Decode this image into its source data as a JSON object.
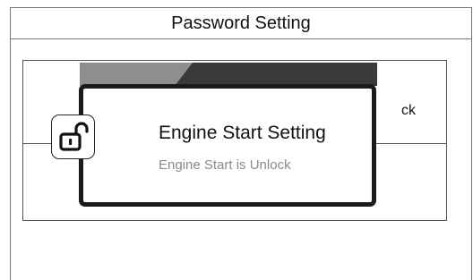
{
  "header": {
    "title": "Password Setting"
  },
  "background": {
    "row_text_fragment": "ck"
  },
  "popup": {
    "title": "Engine Start Setting",
    "message": "Engine Start is Unlock",
    "icon": "unlock-icon"
  }
}
